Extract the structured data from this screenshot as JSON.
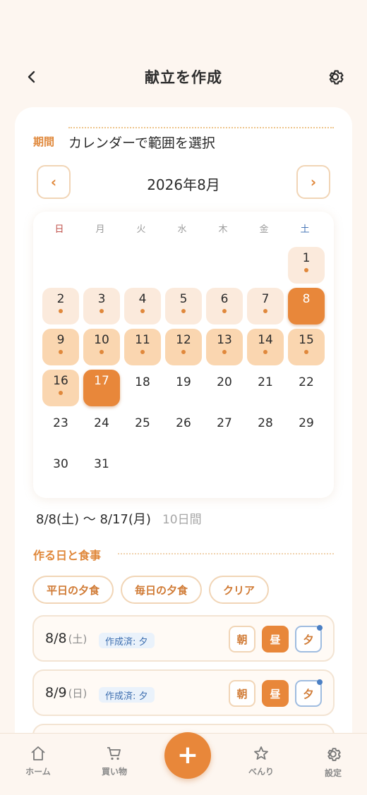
{
  "header": {
    "title": "献立を作成"
  },
  "period": {
    "label": "期間",
    "text": "カレンダーで範囲を選択"
  },
  "calendar": {
    "month_label": "2026年8月",
    "prev": "‹",
    "next": "›",
    "weekdays": [
      "日",
      "月",
      "火",
      "水",
      "木",
      "金",
      "土"
    ],
    "days": [
      {
        "d": "1",
        "col": 6,
        "row": 0,
        "state": "light",
        "dot": true
      },
      {
        "d": "2",
        "col": 0,
        "row": 1,
        "state": "light",
        "dot": true
      },
      {
        "d": "3",
        "col": 1,
        "row": 1,
        "state": "light",
        "dot": true
      },
      {
        "d": "4",
        "col": 2,
        "row": 1,
        "state": "light",
        "dot": true
      },
      {
        "d": "5",
        "col": 3,
        "row": 1,
        "state": "light",
        "dot": true
      },
      {
        "d": "6",
        "col": 4,
        "row": 1,
        "state": "light",
        "dot": true
      },
      {
        "d": "7",
        "col": 5,
        "row": 1,
        "state": "light",
        "dot": true
      },
      {
        "d": "8",
        "col": 6,
        "row": 1,
        "state": "sel",
        "dot": false
      },
      {
        "d": "9",
        "col": 0,
        "row": 2,
        "state": "mid",
        "dot": true
      },
      {
        "d": "10",
        "col": 1,
        "row": 2,
        "state": "mid",
        "dot": true
      },
      {
        "d": "11",
        "col": 2,
        "row": 2,
        "state": "mid",
        "dot": true
      },
      {
        "d": "12",
        "col": 3,
        "row": 2,
        "state": "mid",
        "dot": true
      },
      {
        "d": "13",
        "col": 4,
        "row": 2,
        "state": "mid",
        "dot": true
      },
      {
        "d": "14",
        "col": 5,
        "row": 2,
        "state": "mid",
        "dot": true
      },
      {
        "d": "15",
        "col": 6,
        "row": 2,
        "state": "mid",
        "dot": true
      },
      {
        "d": "16",
        "col": 0,
        "row": 3,
        "state": "mid",
        "dot": true
      },
      {
        "d": "17",
        "col": 1,
        "row": 3,
        "state": "sel",
        "dot": false
      },
      {
        "d": "18",
        "col": 2,
        "row": 3,
        "state": "plain",
        "dot": false
      },
      {
        "d": "19",
        "col": 3,
        "row": 3,
        "state": "plain",
        "dot": false
      },
      {
        "d": "20",
        "col": 4,
        "row": 3,
        "state": "plain",
        "dot": false
      },
      {
        "d": "21",
        "col": 5,
        "row": 3,
        "state": "plain",
        "dot": false
      },
      {
        "d": "22",
        "col": 6,
        "row": 3,
        "state": "plain",
        "dot": false
      },
      {
        "d": "23",
        "col": 0,
        "row": 4,
        "state": "plain",
        "dot": false
      },
      {
        "d": "24",
        "col": 1,
        "row": 4,
        "state": "plain",
        "dot": false
      },
      {
        "d": "25",
        "col": 2,
        "row": 4,
        "state": "plain",
        "dot": false
      },
      {
        "d": "26",
        "col": 3,
        "row": 4,
        "state": "plain",
        "dot": false
      },
      {
        "d": "27",
        "col": 4,
        "row": 4,
        "state": "plain",
        "dot": false
      },
      {
        "d": "28",
        "col": 5,
        "row": 4,
        "state": "plain",
        "dot": false
      },
      {
        "d": "29",
        "col": 6,
        "row": 4,
        "state": "plain",
        "dot": false
      },
      {
        "d": "30",
        "col": 0,
        "row": 5,
        "state": "plain",
        "dot": false
      },
      {
        "d": "31",
        "col": 1,
        "row": 5,
        "state": "plain",
        "dot": false
      }
    ]
  },
  "range": {
    "text": "8/8(土) 〜 8/17(月)",
    "days": "10日間"
  },
  "meals_section": {
    "title": "作る日と食事"
  },
  "chips": [
    "平日の夕食",
    "毎日の夕食",
    "クリア"
  ],
  "meal_rows": [
    {
      "date": "8/8",
      "weekday": "(土)",
      "badge": "作成済: 夕",
      "breakfast": "朝",
      "lunch": "昼",
      "dinner": "夕"
    },
    {
      "date": "8/9",
      "weekday": "(日)",
      "badge": "作成済: 夕",
      "breakfast": "朝",
      "lunch": "昼",
      "dinner": "夕"
    }
  ],
  "bottom_nav": {
    "home": "ホーム",
    "shopping": "買い物",
    "favorites": "べんり",
    "settings": "設定",
    "add": "+"
  },
  "colors": {
    "accent": "#e8873a",
    "accent_light": "#fad6b0",
    "background": "#fdf6f0",
    "badge_blue": "#3e6fb0"
  }
}
